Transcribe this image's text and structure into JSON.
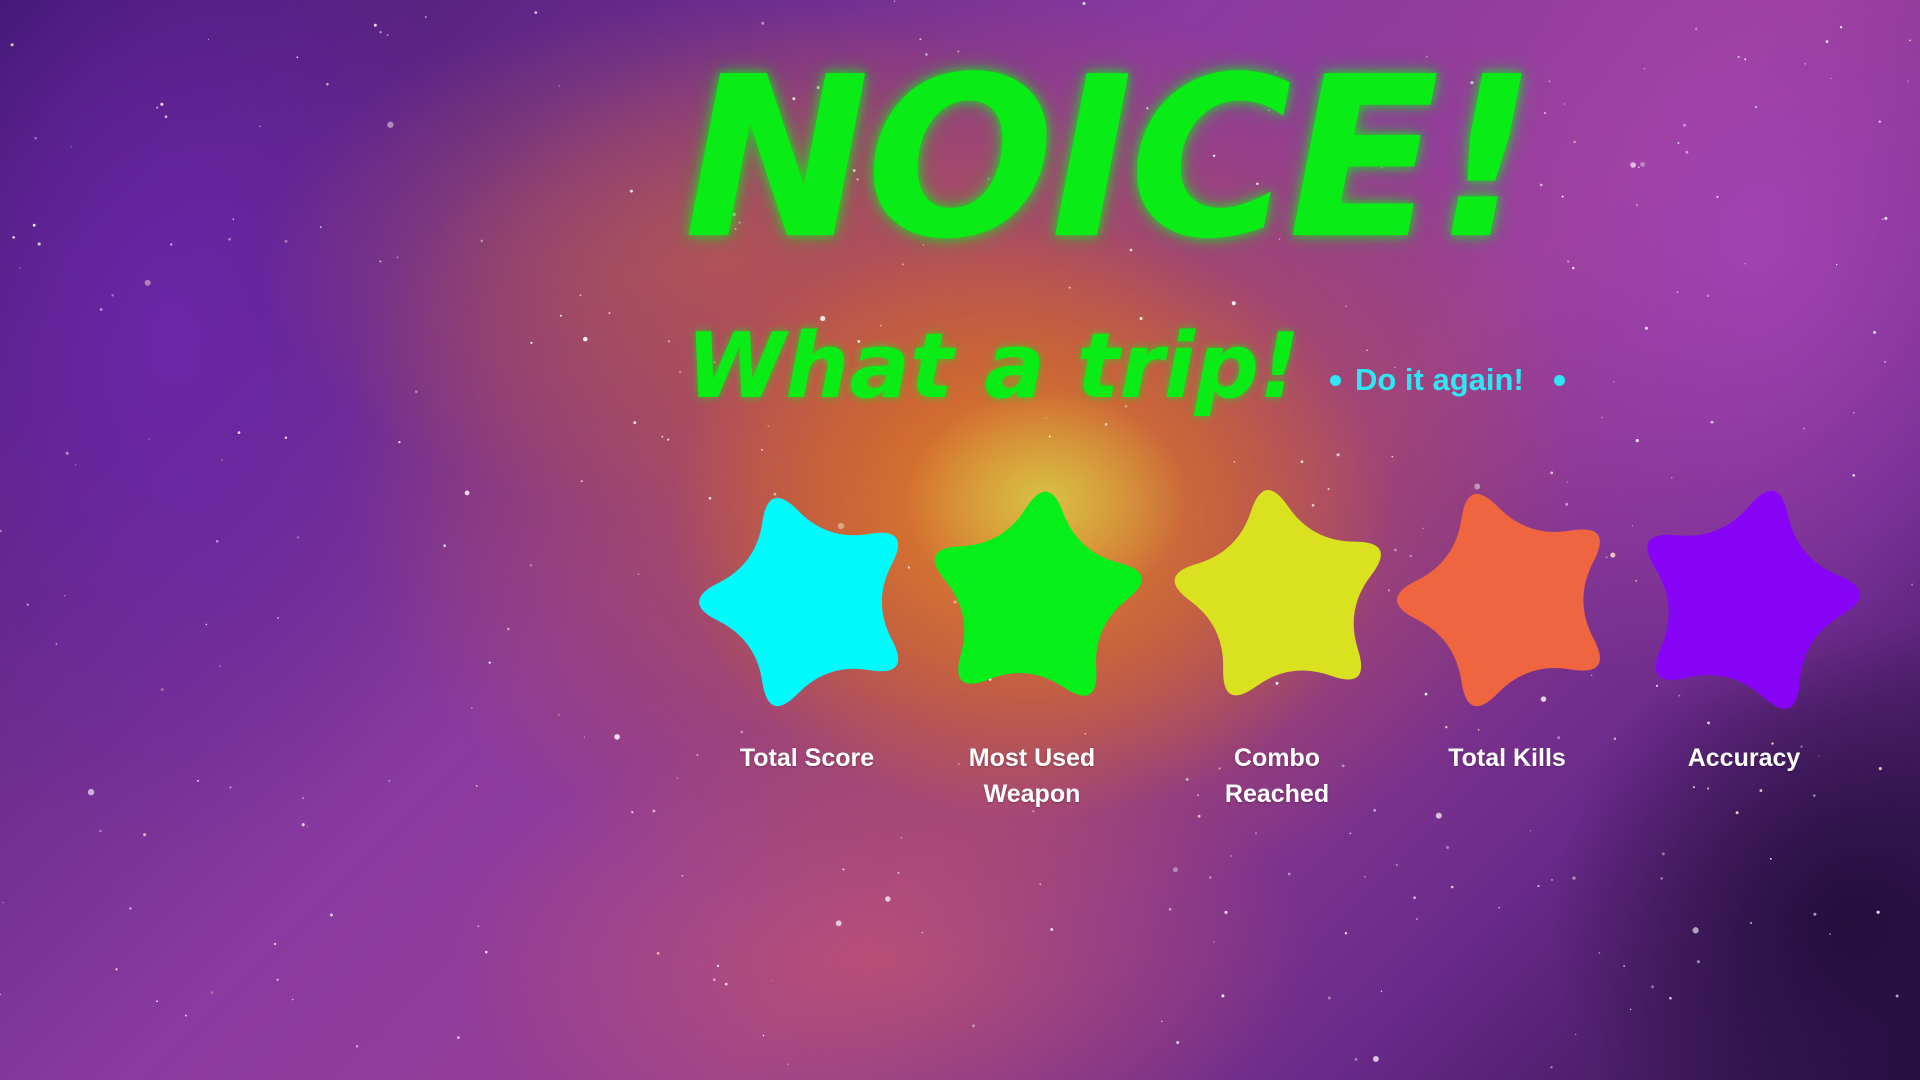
{
  "results": {
    "title": "NOICE!",
    "subtitle": "What a trip!",
    "replay_label": "Do it again!"
  },
  "stats": [
    {
      "label": "Total Score",
      "color": "#00fbfd"
    },
    {
      "label": "Most Used Weapon",
      "color": "#07ef18"
    },
    {
      "label": "Combo Reached",
      "color": "#d9e121"
    },
    {
      "label": "Total Kills",
      "color": "#ee6540"
    },
    {
      "label": "Accuracy",
      "color": "#8704f7"
    }
  ],
  "colors": {
    "title": "#0aec16",
    "replay": "#2ee6f4",
    "stat_label": "#ffffff"
  },
  "icons": {
    "background": "space-nebula",
    "stat_shape": "star-blob-icon",
    "replay_marker": "dot-icon"
  }
}
